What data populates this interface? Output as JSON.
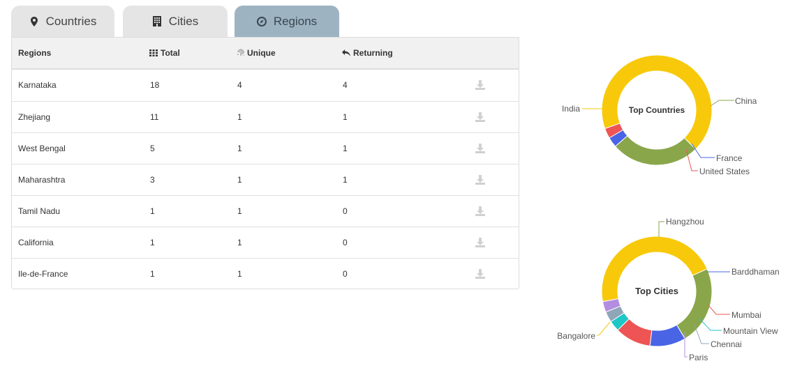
{
  "tabs": [
    {
      "label": "Countries",
      "icon": "map-marker-icon"
    },
    {
      "label": "Cities",
      "icon": "building-icon"
    },
    {
      "label": "Regions",
      "icon": "compass-icon",
      "active": true
    }
  ],
  "table": {
    "headers": {
      "region": "Regions",
      "total": "Total",
      "unique": "Unique",
      "returning": "Returning"
    },
    "rows": [
      {
        "region": "Karnataka",
        "total": "18",
        "unique": "4",
        "returning": "4"
      },
      {
        "region": "Zhejiang",
        "total": "11",
        "unique": "1",
        "returning": "1"
      },
      {
        "region": "West Bengal",
        "total": "5",
        "unique": "1",
        "returning": "1"
      },
      {
        "region": "Maharashtra",
        "total": "3",
        "unique": "1",
        "returning": "1"
      },
      {
        "region": "Tamil Nadu",
        "total": "1",
        "unique": "1",
        "returning": "0"
      },
      {
        "region": "California",
        "total": "1",
        "unique": "1",
        "returning": "0"
      },
      {
        "region": "Ile-de-France",
        "total": "1",
        "unique": "1",
        "returning": "0"
      }
    ],
    "row_action_icon": "download-icon"
  },
  "charts": {
    "top_countries": {
      "title": "Top Countries",
      "slices": [
        {
          "name": "India",
          "value": 68,
          "color": "#f7c90a"
        },
        {
          "name": "China",
          "value": 26,
          "color": "#8aa64b"
        },
        {
          "name": "France",
          "value": 3,
          "color": "#4a64e6"
        },
        {
          "name": "United States",
          "value": 3,
          "color": "#ee5454"
        }
      ]
    },
    "top_cities": {
      "title": "Top Cities",
      "slices": [
        {
          "name": "Bangalore",
          "value": 44,
          "color": "#f7c90a"
        },
        {
          "name": "Hangzhou",
          "value": 22,
          "color": "#8aa64b"
        },
        {
          "name": "Barddhaman",
          "value": 10,
          "color": "#4a64e6"
        },
        {
          "name": "Mumbai",
          "value": 10,
          "color": "#ee5454"
        },
        {
          "name": "Mountain View",
          "value": 3,
          "color": "#1fc6c6"
        },
        {
          "name": "Chennai",
          "value": 3,
          "color": "#8fa6b8"
        },
        {
          "name": "Paris",
          "value": 3,
          "color": "#b38de0"
        }
      ]
    }
  }
}
